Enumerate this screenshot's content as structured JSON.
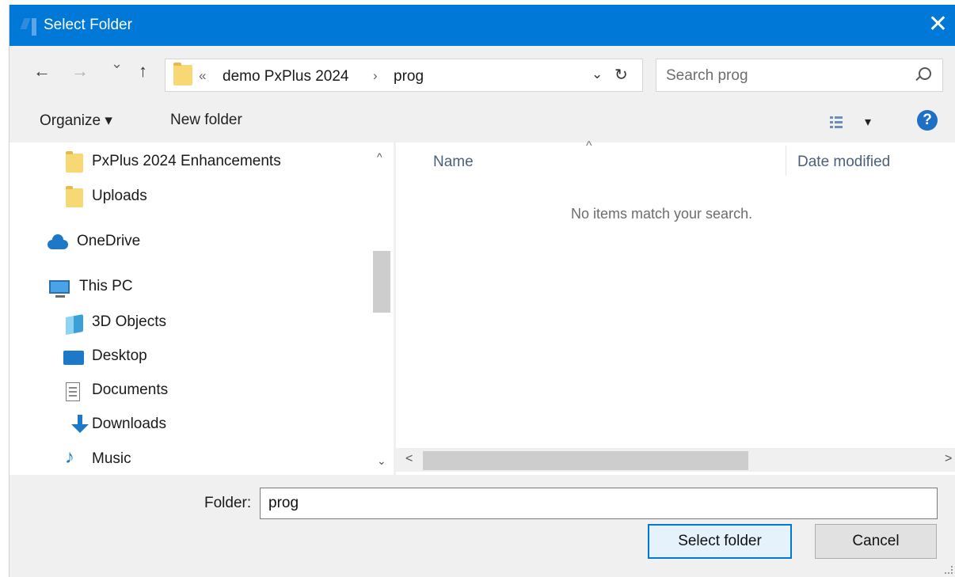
{
  "window": {
    "title": "Select Folder",
    "close_glyph": "✕"
  },
  "nav": {
    "back_glyph": "←",
    "forward_glyph": "→",
    "recent_glyph": "⌄",
    "up_glyph": "↑"
  },
  "address": {
    "overflow_glyph": "«",
    "breadcrumbs": [
      "demo PxPlus 2024",
      "prog"
    ],
    "separator_glyph": "›",
    "dropdown_glyph": "⌄",
    "refresh_glyph": "↻"
  },
  "search": {
    "placeholder": "Search prog"
  },
  "toolbar": {
    "organize_label": "Organize ▾",
    "new_folder_label": "New folder",
    "view_caret": "▾",
    "help_glyph": "?"
  },
  "navpane": {
    "items": [
      {
        "label": "PxPlus 2024 Enhancements",
        "icon": "folder-icon"
      },
      {
        "label": "Uploads",
        "icon": "folder-icon"
      },
      {
        "label": "OneDrive",
        "icon": "onedrive-icon"
      },
      {
        "label": "This PC",
        "icon": "computer-icon"
      },
      {
        "label": "3D Objects",
        "icon": "3d-objects-icon"
      },
      {
        "label": "Desktop",
        "icon": "desktop-icon"
      },
      {
        "label": "Documents",
        "icon": "documents-icon"
      },
      {
        "label": "Downloads",
        "icon": "download-icon"
      },
      {
        "label": "Music",
        "icon": "music-icon"
      }
    ],
    "scroll_up_glyph": "^",
    "scroll_down_glyph": "⌄"
  },
  "content": {
    "columns": {
      "name": "Name",
      "date_modified": "Date modified"
    },
    "sort_glyph": "^",
    "empty_message": "No items match your search.",
    "scroll_left_glyph": "<",
    "scroll_right_glyph": ">"
  },
  "footer": {
    "folder_label": "Folder:",
    "folder_value": "prog",
    "select_label": "Select folder",
    "cancel_label": "Cancel"
  },
  "colors": {
    "titlebar": "#0078d7",
    "accent": "#1e78c8",
    "folder": "#f8d775"
  }
}
